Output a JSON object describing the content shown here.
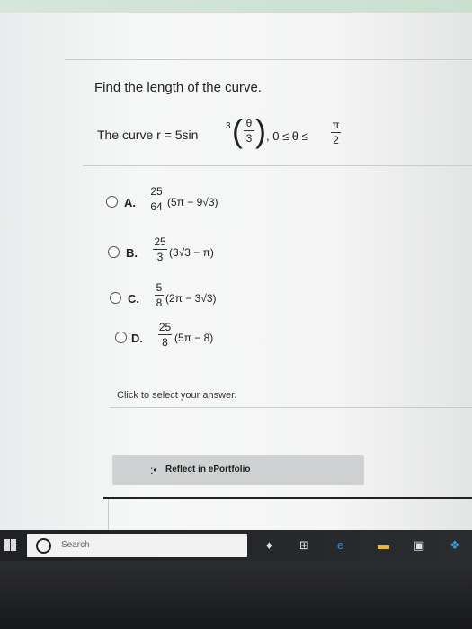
{
  "question": {
    "prompt": "Find the length of the curve.",
    "curve_label": "The curve r = 5sin",
    "curve_exponent": "3",
    "theta_num": "θ",
    "theta_den": "3",
    "range": ", 0 ≤ θ ≤",
    "range_num": "π",
    "range_den": "2"
  },
  "options": [
    {
      "letter": "A.",
      "num": "25",
      "den": "64",
      "expr": "(5π − 9√3)"
    },
    {
      "letter": "B.",
      "num": "25",
      "den": "3",
      "expr": "(3√3 − π)"
    },
    {
      "letter": "C.",
      "num": "5",
      "den": "8",
      "expr": "(2π − 3√3)"
    },
    {
      "letter": "D.",
      "num": "25",
      "den": "8",
      "expr": "(5π − 8)"
    }
  ],
  "instruction": "Click to select your answer.",
  "reflect_button": "Reflect in ePortfolio",
  "taskbar": {
    "search_placeholder": "Search"
  }
}
